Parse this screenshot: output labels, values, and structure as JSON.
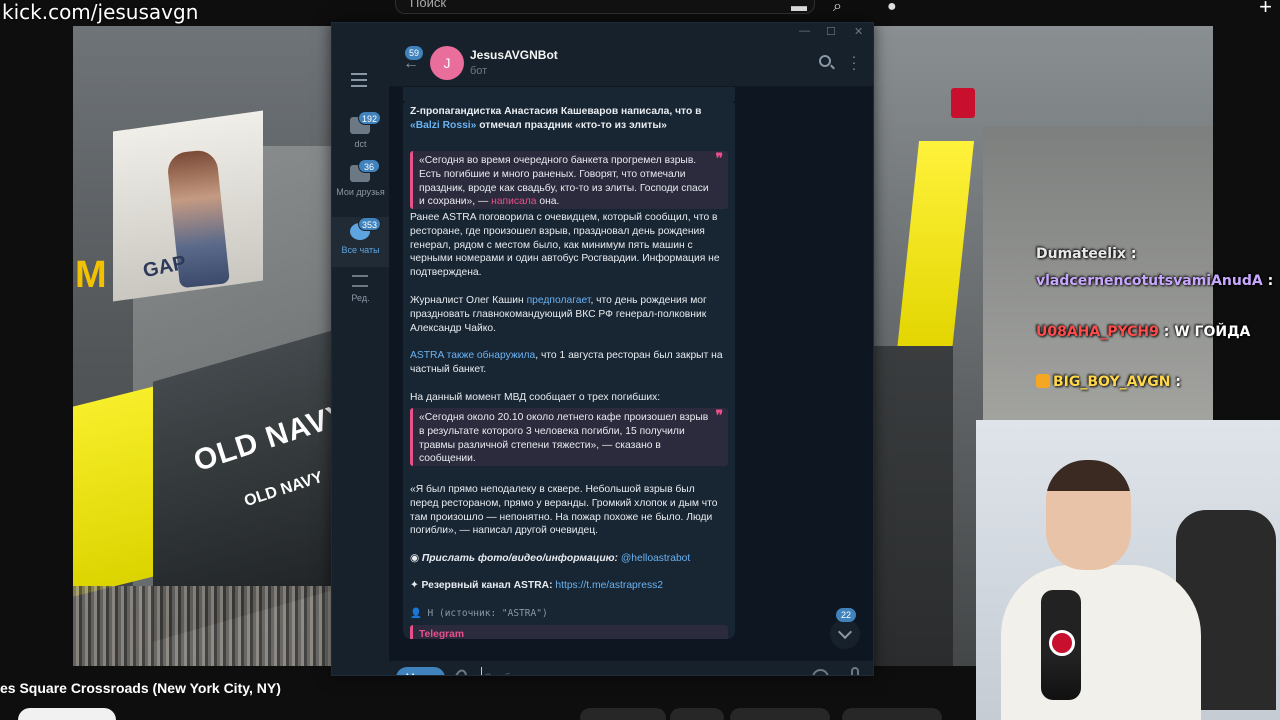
{
  "overlay": {
    "url": "kick.com/jesusavgn",
    "search_placeholder": "Поиск",
    "video_title": "es Square Crossroads (New York City, NY)"
  },
  "billboards": {
    "gap": "GAP",
    "mcdonalds": "M",
    "old_navy": "OLD NAVY",
    "old_navy_small": "OLD NAVY"
  },
  "stream_chat": [
    {
      "user": "Dumateelix",
      "message": ":"
    },
    {
      "user": "vladcernencotutsvamiAnudA",
      "message": ":"
    },
    {
      "user": "U08AHA_PYCH9",
      "message": ": W ГОЙДА"
    },
    {
      "user": "BIG_BOY_AVGN",
      "message": ":"
    }
  ],
  "telegram": {
    "window_controls": [
      "—",
      "☐",
      "✕"
    ],
    "folders": [
      {
        "label": "dct",
        "badge": "192"
      },
      {
        "label": "Мои друзья",
        "badge": "36"
      },
      {
        "label": "Все чаты",
        "badge": "353"
      },
      {
        "label": "Ред.",
        "badge": ""
      }
    ],
    "header": {
      "back_badge": "59",
      "avatar_letter": "J",
      "bot_name": "JesusAVGNBot",
      "bot_status": "бот"
    },
    "message": {
      "intro_a": "Z-пропагандистка Анастасия Кашеваров написала, что в ",
      "intro_link": "«Balzi Rossi»",
      "intro_b": " отмечал праздник «кто-то из элиты»",
      "quote1_a": "«Сегодня во время очередного банкета прогремел взрыв. Есть погибшие и много раненых. Говорят, что отмечали праздник, вроде как свадьбу, кто-то из элиты. Господи спаси и сохрани», — ",
      "quote1_link": "написала",
      "quote1_b": " она.",
      "p2": "Ранее ASTRA поговорила с очевидцем, который сообщил, что в ресторане, где произошел взрыв, праздновал день рождения генерал, рядом с местом было, как минимум пять машин с черными номерами и один автобус Росгвардии. Информация не подтверждена.",
      "p3_a": "Журналист Олег Кашин ",
      "p3_link": "предполагает",
      "p3_b": ", что день рождения мог праздновать главнокомандующий ВКС РФ генерал-полковник Александр Чайко.",
      "p4_link": "ASTRA также обнаружила",
      "p4_b": ", что 1 августа ресторан был закрыт на частный банкет.",
      "p5": "На данный момент МВД сообщает о трех погибших:",
      "quote2": "«Сегодня около 20.10 около летнего кафе произошел взрыв в результате которого 3 человека погибли, 15 получили травмы различной степени тяжести», — сказано в сообщении.",
      "p6": "«Я был прямо неподалеку в сквере. Небольшой взрыв был перед рестораном, прямо у веранды. Громкий хлопок и дым что там произошло — непонятно. На пожар похоже не было. Люди погибли», — написал другой очевидец.",
      "p7_label": "Прислать фото/видео/информацию:",
      "p7_link": "@helloastrabot",
      "p8_label": "Резервный канал ASTRA:",
      "p8_link": "https://t.me/astrapress2",
      "source_line": "👤 Н (источник: \"ASTRA\")",
      "telegram_card": "Telegram",
      "quote_mark": "❞"
    },
    "scroll_badge": "22",
    "composer": {
      "menu_label": "Меню",
      "placeholder": "Сообщение..."
    }
  }
}
